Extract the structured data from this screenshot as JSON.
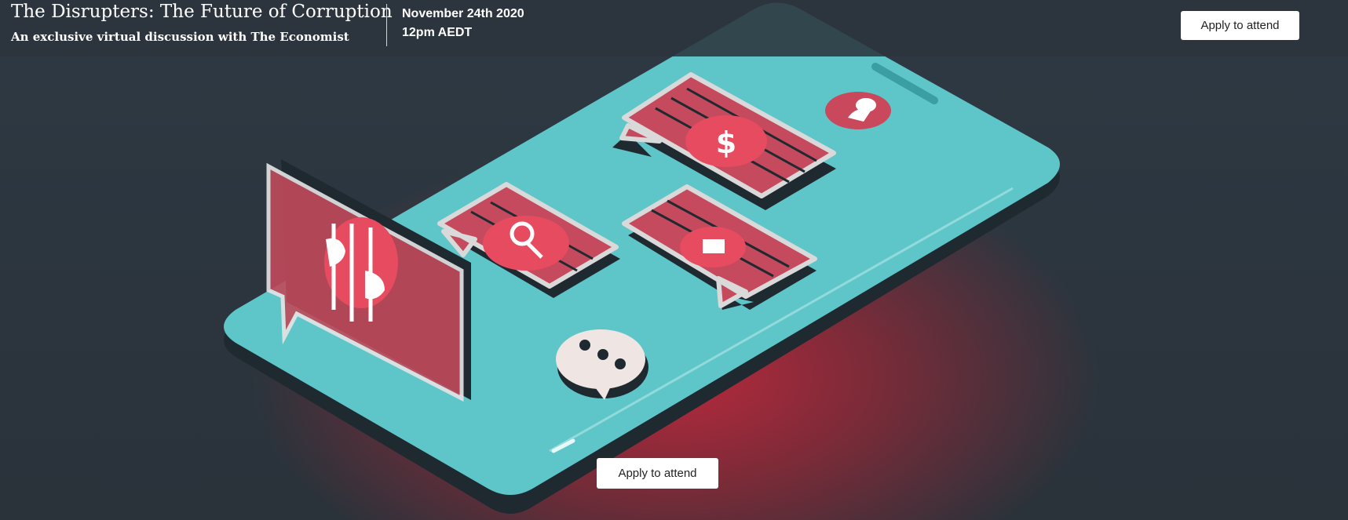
{
  "event": {
    "title": "The Disrupters: The Future of Corruption",
    "subtitle": "An exclusive virtual discussion with The Economist",
    "date": "November 24th 2020",
    "time": "12pm AEDT"
  },
  "actions": {
    "apply_top_label": "Apply to attend",
    "apply_bottom_label": "Apply to attend"
  },
  "illustration": {
    "colors": {
      "phone_screen": "#5ec6c9",
      "phone_side": "#1f2a30",
      "bubble_red": "#c64a5d",
      "icon_red": "#e64b60",
      "background_glow": "#b8283c"
    },
    "icons": [
      "handcuffed-hands-icon",
      "magnifier-icon",
      "dollar-icon",
      "envelope-icon",
      "user-icon",
      "speech-dots-icon"
    ]
  }
}
